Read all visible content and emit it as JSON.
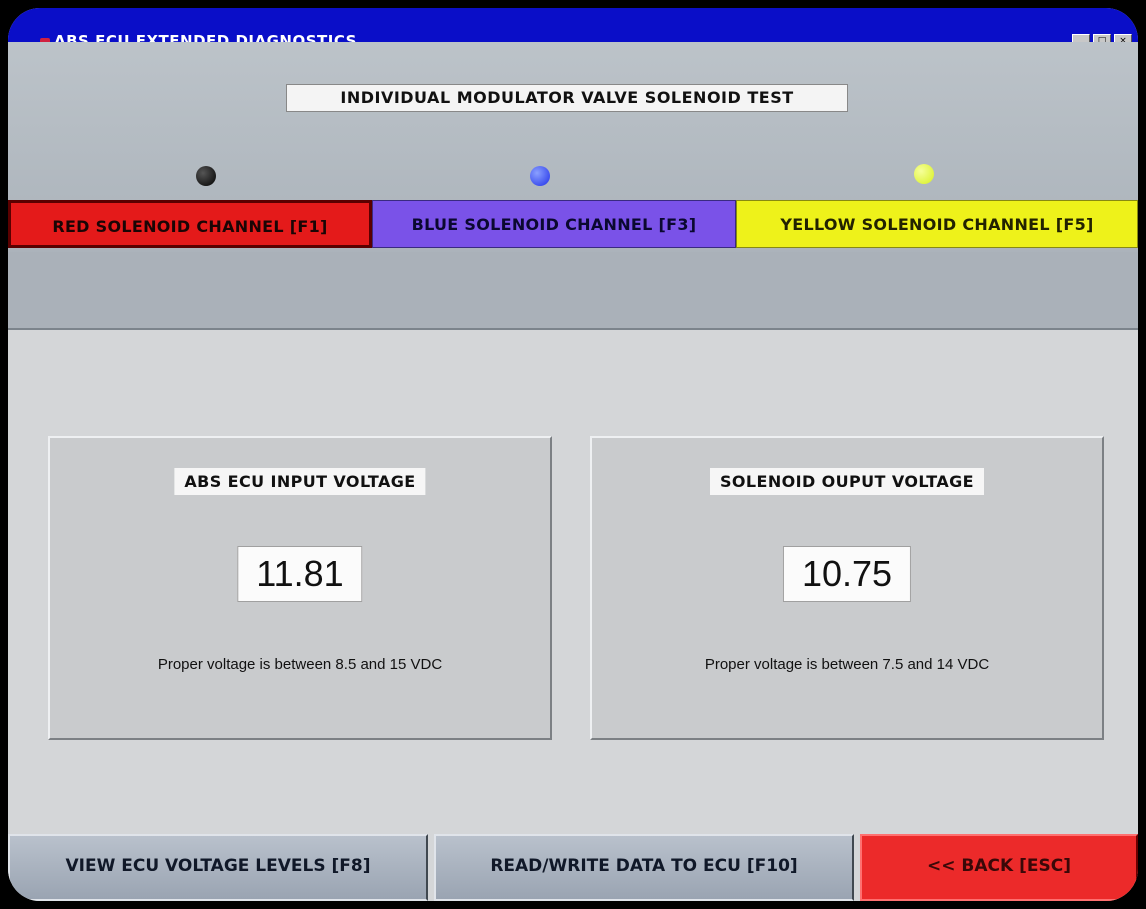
{
  "window": {
    "title": "ABS ECU EXTENDED DIAGNOSTICS",
    "controls": [
      "_",
      "□",
      "×"
    ]
  },
  "header": {
    "test_title": "INDIVIDUAL MODULATOR VALVE SOLENOID TEST"
  },
  "indicators": [
    {
      "name": "red",
      "color": "#000000"
    },
    {
      "name": "blue",
      "color": "#2030e8"
    },
    {
      "name": "yellow",
      "color": "#d8f020"
    }
  ],
  "channels": {
    "red_label": "RED SOLENOID CHANNEL [F1]",
    "blue_label": "BLUE SOLENOID CHANNEL [F3]",
    "yellow_label": "YELLOW SOLENOID CHANNEL [F5]"
  },
  "panels": {
    "input": {
      "label": "ABS ECU INPUT VOLTAGE",
      "value": "11.81",
      "note": "Proper voltage is between 8.5 and 15  VDC"
    },
    "output": {
      "label": "SOLENOID OUPUT VOLTAGE",
      "value": "10.75",
      "note": "Proper voltage is between 7.5 and 14 VDC"
    }
  },
  "footer": {
    "view_label": "VIEW ECU VOLTAGE LEVELS   [F8]",
    "readwrite_label": "READ/WRITE DATA TO ECU   [F10]",
    "back_label": "<< BACK  [ESC]"
  },
  "colors": {
    "titlebar": "#0a0ec8",
    "red_channel": "#e41a1a",
    "blue_channel": "#7a52e8",
    "yellow_channel": "#eef21a",
    "back_button": "#ec2a2a"
  }
}
